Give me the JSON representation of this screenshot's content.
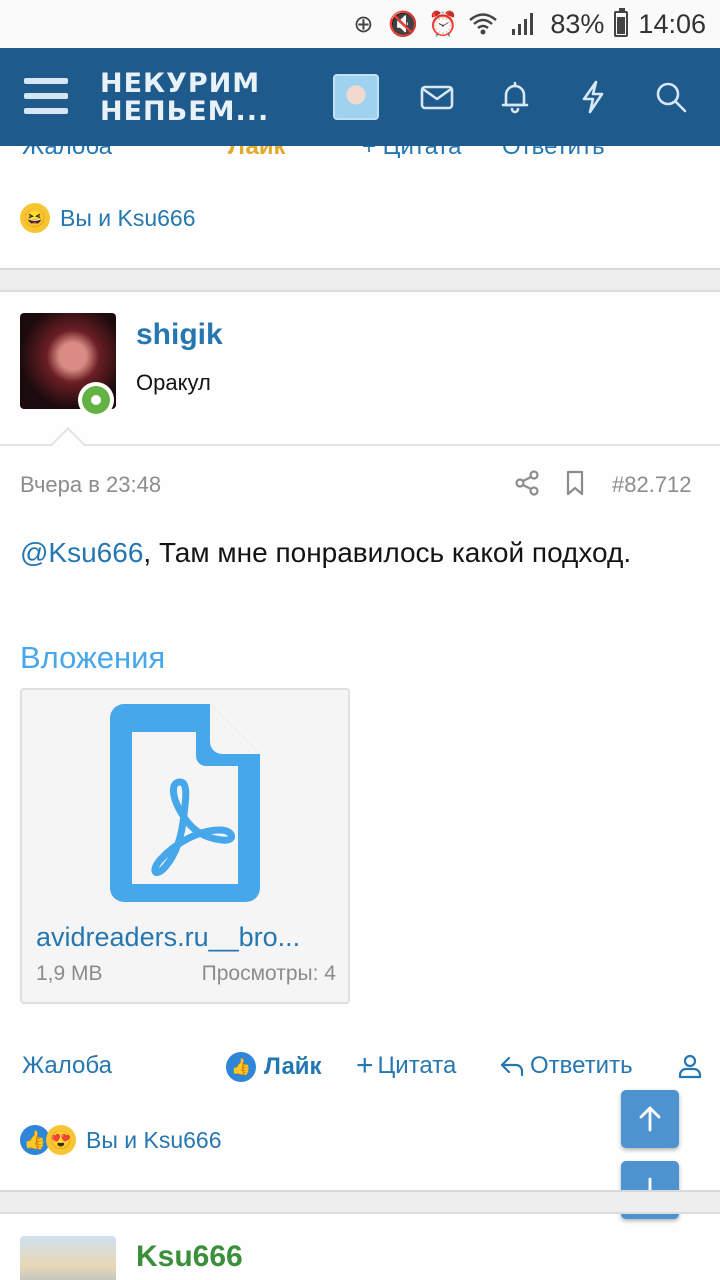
{
  "status_bar": {
    "battery_percent": "83%",
    "time": "14:06"
  },
  "header": {
    "logo_line1": "НЕКУРИМ",
    "logo_line2": "НЕПЬЕМ..."
  },
  "previous_post": {
    "actions_partial": [
      "Жалоба",
      "Лайк",
      "+ Цитата",
      "Ответить"
    ],
    "reactions_text": "Вы и Ksu666"
  },
  "post": {
    "username": "shigik",
    "user_title": "Оракул",
    "date": "Вчера в 23:48",
    "post_number": "#82.712",
    "mention": "@Ksu666",
    "message_text": ", Там мне понравилось какой подход.",
    "attachments_heading": "Вложения",
    "attachment": {
      "file_name": "avidreaders.ru__bro...",
      "file_size": "1,9 MB",
      "views": "Просмотры: 4"
    },
    "actions": {
      "report": "Жалоба",
      "like": "Лайк",
      "quote": "Цитата",
      "reply": "Ответить"
    },
    "reactions_text": "Вы и Ksu666"
  },
  "next_post": {
    "username": "Ksu666"
  },
  "colors": {
    "header_bg": "#1f5a8c",
    "link": "#2577b1",
    "attachments_heading": "#47a7eb",
    "online": "#63b344",
    "next_username": "#3b8f3a"
  }
}
